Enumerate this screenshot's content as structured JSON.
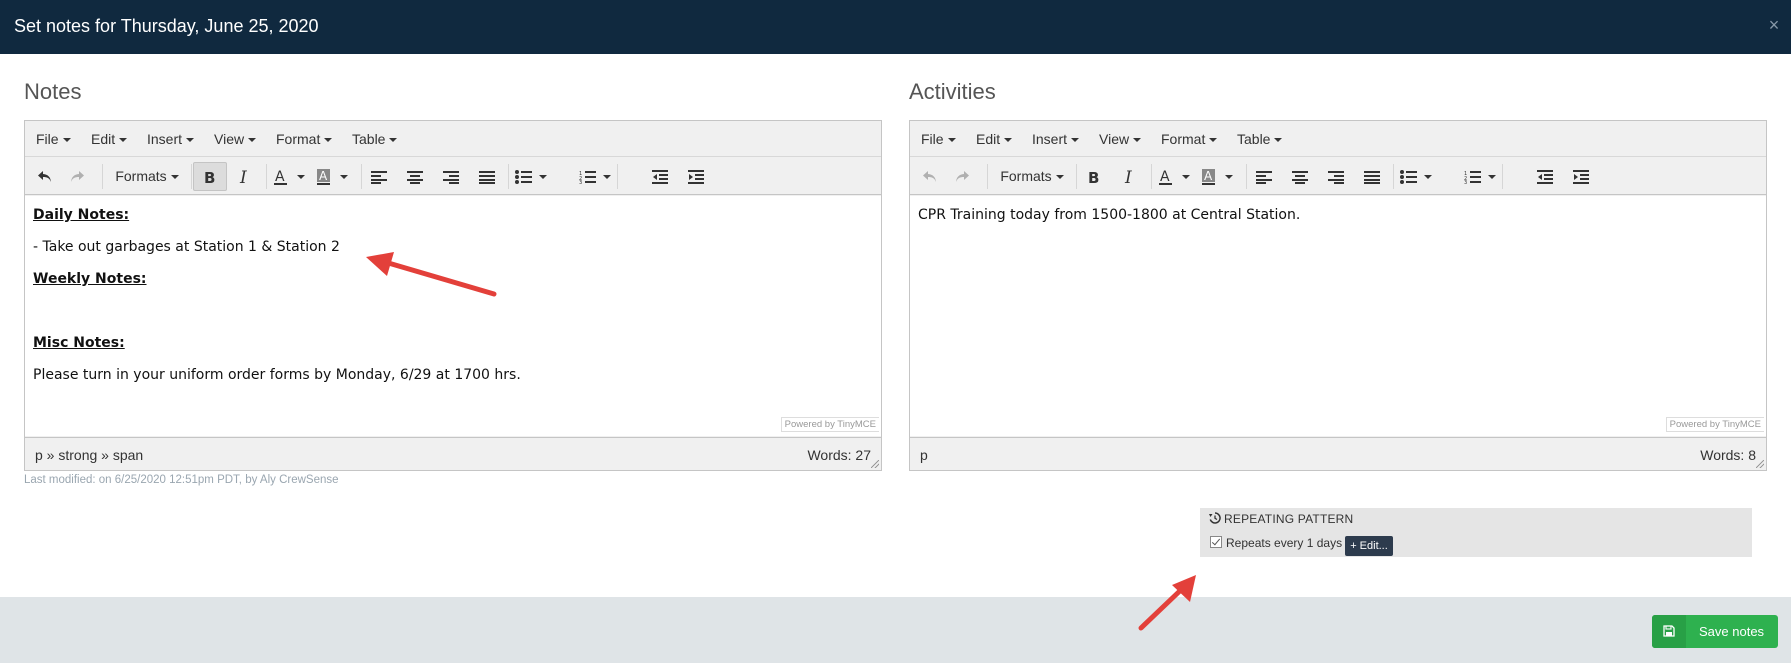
{
  "modal": {
    "title": "Set notes for Thursday, June 25, 2020",
    "close_symbol": "×"
  },
  "notes": {
    "title": "Notes",
    "menu": [
      "File",
      "Edit",
      "Insert",
      "View",
      "Format",
      "Table"
    ],
    "formats_label": "Formats",
    "content": {
      "daily_heading": "Daily Notes: ",
      "daily_item": "- Take out garbages at Station 1 & Station 2",
      "weekly_heading": "Weekly Notes:",
      "misc_heading": "Misc Notes: ",
      "misc_text": "Please turn in your uniform order forms by Monday, 6/29 at 1700 hrs."
    },
    "powered_by": "Powered by TinyMCE",
    "status_path": "p » strong » span",
    "word_count": "Words: 27",
    "last_modified": "Last modified: on 6/25/2020 12:51pm PDT, by Aly CrewSense"
  },
  "activities": {
    "title": "Activities",
    "menu": [
      "File",
      "Edit",
      "Insert",
      "View",
      "Format",
      "Table"
    ],
    "formats_label": "Formats",
    "content": {
      "line1": "CPR Training today from 1500-1800 at Central Station."
    },
    "powered_by": "Powered by TinyMCE",
    "status_path": "p",
    "word_count": "Words: 8"
  },
  "repeating_pattern": {
    "title": "REPEATING PATTERN",
    "checked": true,
    "label": "Repeats every 1 days",
    "edit_label": "+ Edit..."
  },
  "footer": {
    "save_label": "Save notes"
  },
  "colors": {
    "header_bg": "#10293f",
    "footer_bg": "#dfe4e7",
    "save_green": "#2eb14f",
    "arrow_red": "#e3403a",
    "edit_btn": "#2d3b4d"
  },
  "icons": [
    "close-icon",
    "undo-icon",
    "redo-icon",
    "bold-icon",
    "italic-icon",
    "text-color-icon",
    "background-color-icon",
    "align-left-icon",
    "align-center-icon",
    "align-right-icon",
    "align-justify-icon",
    "bullet-list-icon",
    "numbered-list-icon",
    "outdent-icon",
    "indent-icon",
    "history-icon",
    "save-icon"
  ]
}
